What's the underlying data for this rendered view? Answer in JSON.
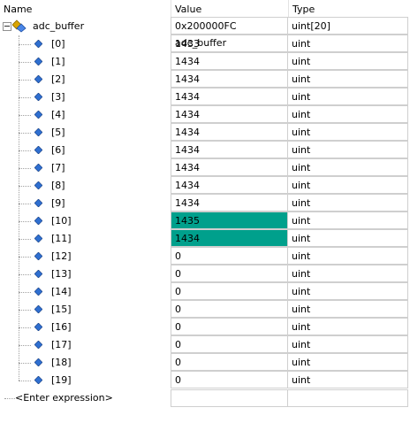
{
  "columns": {
    "name": "Name",
    "value": "Value",
    "type": "Type"
  },
  "root": {
    "name": "adc_buffer",
    "value": "0x200000FC adc_buffer",
    "type": "uint[20]",
    "icon": "struct-variable-icon",
    "expanded": true
  },
  "items": [
    {
      "name": "[0]",
      "value": "1433",
      "type": "uint",
      "changed": false
    },
    {
      "name": "[1]",
      "value": "1434",
      "type": "uint",
      "changed": false
    },
    {
      "name": "[2]",
      "value": "1434",
      "type": "uint",
      "changed": false
    },
    {
      "name": "[3]",
      "value": "1434",
      "type": "uint",
      "changed": false
    },
    {
      "name": "[4]",
      "value": "1434",
      "type": "uint",
      "changed": false
    },
    {
      "name": "[5]",
      "value": "1434",
      "type": "uint",
      "changed": false
    },
    {
      "name": "[6]",
      "value": "1434",
      "type": "uint",
      "changed": false
    },
    {
      "name": "[7]",
      "value": "1434",
      "type": "uint",
      "changed": false
    },
    {
      "name": "[8]",
      "value": "1434",
      "type": "uint",
      "changed": false
    },
    {
      "name": "[9]",
      "value": "1434",
      "type": "uint",
      "changed": false
    },
    {
      "name": "[10]",
      "value": "1435",
      "type": "uint",
      "changed": true
    },
    {
      "name": "[11]",
      "value": "1434",
      "type": "uint",
      "changed": true
    },
    {
      "name": "[12]",
      "value": "0",
      "type": "uint",
      "changed": false
    },
    {
      "name": "[13]",
      "value": "0",
      "type": "uint",
      "changed": false
    },
    {
      "name": "[14]",
      "value": "0",
      "type": "uint",
      "changed": false
    },
    {
      "name": "[15]",
      "value": "0",
      "type": "uint",
      "changed": false
    },
    {
      "name": "[16]",
      "value": "0",
      "type": "uint",
      "changed": false
    },
    {
      "name": "[17]",
      "value": "0",
      "type": "uint",
      "changed": false
    },
    {
      "name": "[18]",
      "value": "0",
      "type": "uint",
      "changed": false
    },
    {
      "name": "[19]",
      "value": "0",
      "type": "uint",
      "changed": false
    }
  ],
  "enter_expression": "<Enter expression>",
  "colors": {
    "changed_highlight": "#00a08c",
    "grid": "#cfcfcf",
    "element_icon": "#2f6fd0"
  }
}
